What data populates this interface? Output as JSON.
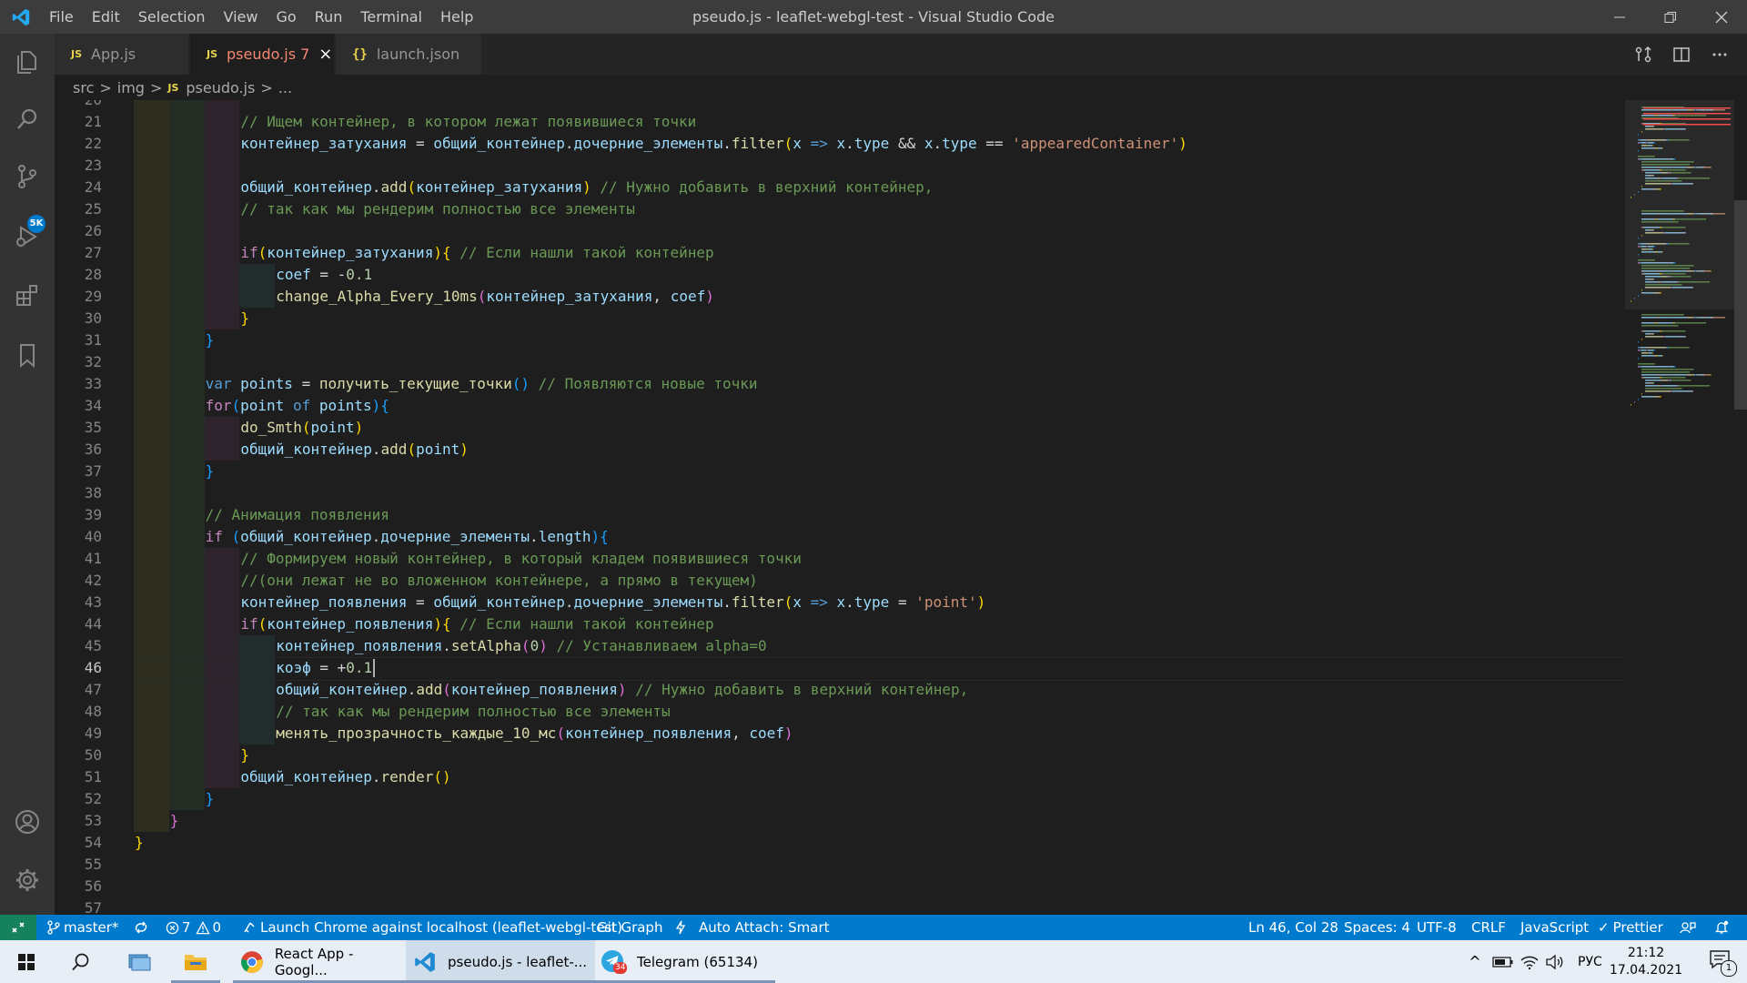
{
  "window": {
    "title": "pseudo.js - leaflet-webgl-test - Visual Studio Code",
    "menu": [
      "File",
      "Edit",
      "Selection",
      "View",
      "Go",
      "Run",
      "Terminal",
      "Help"
    ]
  },
  "activity_bar": {
    "items": [
      "explorer-icon",
      "search-icon",
      "source-control-icon",
      "run-debug-icon",
      "extensions-icon",
      "bookmarks-icon"
    ],
    "source_control_badge": "5K",
    "bottom_items": [
      "account-icon",
      "settings-gear-icon"
    ]
  },
  "tabs": [
    {
      "icon": "JS",
      "label": "App.js",
      "active": false
    },
    {
      "icon": "JS",
      "label": "pseudo.js 7",
      "active": true
    },
    {
      "icon": "{}",
      "label": "launch.json",
      "active": false
    }
  ],
  "breadcrumb": {
    "parts": [
      "src",
      "img"
    ],
    "file_icon": "JS",
    "file": "pseudo.js",
    "tail": "..."
  },
  "editor": {
    "current_line": 46,
    "lines": [
      {
        "n": 20,
        "indent": 3,
        "tokens": []
      },
      {
        "n": 21,
        "indent": 3,
        "tokens": [
          [
            "c",
            "// Ищем контейнер, в котором лежат появившиеся точки"
          ]
        ]
      },
      {
        "n": 22,
        "indent": 3,
        "tokens": [
          [
            "v",
            "контейнер_затухания"
          ],
          [
            "p",
            " = "
          ],
          [
            "v",
            "общий_контейнер"
          ],
          [
            "p",
            "."
          ],
          [
            "v",
            "дочерние_элементы"
          ],
          [
            "p",
            "."
          ],
          [
            "f",
            "filter"
          ],
          [
            "b1",
            "("
          ],
          [
            "v",
            "x"
          ],
          [
            "p",
            " "
          ],
          [
            "k",
            "=>"
          ],
          [
            "p",
            " "
          ],
          [
            "v",
            "x"
          ],
          [
            "p",
            "."
          ],
          [
            "v",
            "type"
          ],
          [
            "p",
            " && "
          ],
          [
            "v",
            "x"
          ],
          [
            "p",
            "."
          ],
          [
            "v",
            "type"
          ],
          [
            "p",
            " == "
          ],
          [
            "s",
            "'appearedContainer'"
          ],
          [
            "b1",
            ")"
          ]
        ]
      },
      {
        "n": 23,
        "indent": 3,
        "tokens": []
      },
      {
        "n": 24,
        "indent": 3,
        "tokens": [
          [
            "v",
            "общий_контейнер"
          ],
          [
            "p",
            "."
          ],
          [
            "f",
            "add"
          ],
          [
            "b1",
            "("
          ],
          [
            "v",
            "контейнер_затухания"
          ],
          [
            "b1",
            ")"
          ],
          [
            "p",
            " "
          ],
          [
            "c",
            "// Нужно добавить в верхний контейнер,"
          ]
        ]
      },
      {
        "n": 25,
        "indent": 3,
        "tokens": [
          [
            "c",
            "// так как мы рендерим полностью все элементы"
          ]
        ]
      },
      {
        "n": 26,
        "indent": 3,
        "tokens": []
      },
      {
        "n": 27,
        "indent": 3,
        "tokens": [
          [
            "kc",
            "if"
          ],
          [
            "b1",
            "("
          ],
          [
            "v",
            "контейнер_затухания"
          ],
          [
            "b1",
            ")"
          ],
          [
            "b1",
            "{"
          ],
          [
            "p",
            " "
          ],
          [
            "c",
            "// Если нашли такой контейнер"
          ]
        ]
      },
      {
        "n": 28,
        "indent": 4,
        "tokens": [
          [
            "v",
            "coef"
          ],
          [
            "p",
            " = "
          ],
          [
            "o",
            "-"
          ],
          [
            "nm",
            "0.1"
          ]
        ]
      },
      {
        "n": 29,
        "indent": 4,
        "tokens": [
          [
            "f",
            "change_Alpha_Every_10ms"
          ],
          [
            "b2",
            "("
          ],
          [
            "v",
            "контейнер_затухания"
          ],
          [
            "p",
            ", "
          ],
          [
            "v",
            "coef"
          ],
          [
            "b2",
            ")"
          ]
        ]
      },
      {
        "n": 30,
        "indent": 3,
        "tokens": [
          [
            "b1",
            "}"
          ]
        ]
      },
      {
        "n": 31,
        "indent": 2,
        "tokens": [
          [
            "b3",
            "}"
          ]
        ]
      },
      {
        "n": 32,
        "indent": 2,
        "tokens": []
      },
      {
        "n": 33,
        "indent": 2,
        "tokens": [
          [
            "k",
            "var"
          ],
          [
            "p",
            " "
          ],
          [
            "v",
            "points"
          ],
          [
            "p",
            " = "
          ],
          [
            "f",
            "получить_текущие_точки"
          ],
          [
            "b3",
            "()"
          ],
          [
            "p",
            " "
          ],
          [
            "c",
            "// Появляются новые точки"
          ]
        ]
      },
      {
        "n": 34,
        "indent": 2,
        "tokens": [
          [
            "kc",
            "for"
          ],
          [
            "b3",
            "("
          ],
          [
            "v",
            "point"
          ],
          [
            "p",
            " "
          ],
          [
            "k",
            "of"
          ],
          [
            "p",
            " "
          ],
          [
            "v",
            "points"
          ],
          [
            "b3",
            ")"
          ],
          [
            "b3",
            "{"
          ]
        ]
      },
      {
        "n": 35,
        "indent": 3,
        "tokens": [
          [
            "f",
            "do_Smth"
          ],
          [
            "b1",
            "("
          ],
          [
            "v",
            "point"
          ],
          [
            "b1",
            ")"
          ]
        ]
      },
      {
        "n": 36,
        "indent": 3,
        "tokens": [
          [
            "v",
            "общий_контейнер"
          ],
          [
            "p",
            "."
          ],
          [
            "f",
            "add"
          ],
          [
            "b1",
            "("
          ],
          [
            "v",
            "point"
          ],
          [
            "b1",
            ")"
          ]
        ]
      },
      {
        "n": 37,
        "indent": 2,
        "tokens": [
          [
            "b3",
            "}"
          ]
        ]
      },
      {
        "n": 38,
        "indent": 2,
        "tokens": []
      },
      {
        "n": 39,
        "indent": 2,
        "tokens": [
          [
            "c",
            "// Анимация появления"
          ]
        ]
      },
      {
        "n": 40,
        "indent": 2,
        "tokens": [
          [
            "kc",
            "if"
          ],
          [
            "p",
            " "
          ],
          [
            "b3",
            "("
          ],
          [
            "v",
            "общий_контейнер"
          ],
          [
            "p",
            "."
          ],
          [
            "v",
            "дочерние_элементы"
          ],
          [
            "p",
            "."
          ],
          [
            "v",
            "length"
          ],
          [
            "b3",
            ")"
          ],
          [
            "b3",
            "{"
          ]
        ]
      },
      {
        "n": 41,
        "indent": 3,
        "tokens": [
          [
            "c",
            "// Формируем новый контейнер, в который кладем появившиеся точки"
          ]
        ]
      },
      {
        "n": 42,
        "indent": 3,
        "tokens": [
          [
            "c",
            "//(они лежат не во вложенном контейнере, а прямо в текущем)"
          ]
        ]
      },
      {
        "n": 43,
        "indent": 3,
        "tokens": [
          [
            "v",
            "контейнер_появления"
          ],
          [
            "p",
            " = "
          ],
          [
            "v",
            "общий_контейнер"
          ],
          [
            "p",
            "."
          ],
          [
            "v",
            "дочерние_элементы"
          ],
          [
            "p",
            "."
          ],
          [
            "f",
            "filter"
          ],
          [
            "b1",
            "("
          ],
          [
            "v",
            "x"
          ],
          [
            "p",
            " "
          ],
          [
            "k",
            "=>"
          ],
          [
            "p",
            " "
          ],
          [
            "v",
            "x"
          ],
          [
            "p",
            "."
          ],
          [
            "v",
            "type"
          ],
          [
            "p",
            " = "
          ],
          [
            "s",
            "'point'"
          ],
          [
            "b1",
            ")"
          ]
        ]
      },
      {
        "n": 44,
        "indent": 3,
        "tokens": [
          [
            "kc",
            "if"
          ],
          [
            "b1",
            "("
          ],
          [
            "v",
            "контейнер_появления"
          ],
          [
            "b1",
            ")"
          ],
          [
            "b1",
            "{"
          ],
          [
            "p",
            " "
          ],
          [
            "c",
            "// Если нашли такой контейнер"
          ]
        ]
      },
      {
        "n": 45,
        "indent": 4,
        "tokens": [
          [
            "v",
            "контейнер_появления"
          ],
          [
            "p",
            "."
          ],
          [
            "f",
            "setAlpha"
          ],
          [
            "b2",
            "("
          ],
          [
            "nm",
            "0"
          ],
          [
            "b2",
            ")"
          ],
          [
            "p",
            " "
          ],
          [
            "c",
            "// Устанавливаем alpha=0"
          ]
        ]
      },
      {
        "n": 46,
        "indent": 4,
        "tokens": [
          [
            "v",
            "коэф"
          ],
          [
            "p",
            " = "
          ],
          [
            "o",
            "+"
          ],
          [
            "nm",
            "0.1"
          ]
        ]
      },
      {
        "n": 47,
        "indent": 4,
        "tokens": [
          [
            "v",
            "общий_контейнер"
          ],
          [
            "p",
            "."
          ],
          [
            "f",
            "add"
          ],
          [
            "b2",
            "("
          ],
          [
            "v",
            "контейнер_появления"
          ],
          [
            "b2",
            ")"
          ],
          [
            "p",
            " "
          ],
          [
            "c",
            "// Нужно добавить в верхний контейнер,"
          ]
        ]
      },
      {
        "n": 48,
        "indent": 4,
        "tokens": [
          [
            "c",
            "// так как мы рендерим полностью все элементы"
          ]
        ]
      },
      {
        "n": 49,
        "indent": 4,
        "tokens": [
          [
            "f",
            "менять_прозрачность_каждые_10_мс"
          ],
          [
            "b2",
            "("
          ],
          [
            "v",
            "контейнер_появления"
          ],
          [
            "p",
            ", "
          ],
          [
            "v",
            "coef"
          ],
          [
            "b2",
            ")"
          ]
        ]
      },
      {
        "n": 50,
        "indent": 3,
        "tokens": [
          [
            "b1",
            "}"
          ]
        ]
      },
      {
        "n": 51,
        "indent": 3,
        "tokens": [
          [
            "v",
            "общий_контейнер"
          ],
          [
            "p",
            "."
          ],
          [
            "f",
            "render"
          ],
          [
            "b1",
            "()"
          ]
        ]
      },
      {
        "n": 52,
        "indent": 2,
        "tokens": [
          [
            "b3",
            "}"
          ]
        ]
      },
      {
        "n": 53,
        "indent": 1,
        "tokens": [
          [
            "b2",
            "}"
          ]
        ]
      },
      {
        "n": 54,
        "indent": 0,
        "tokens": [
          [
            "b1",
            "}"
          ]
        ]
      },
      {
        "n": 55,
        "indent": 0,
        "tokens": []
      },
      {
        "n": 56,
        "indent": 0,
        "tokens": []
      },
      {
        "n": 57,
        "indent": 0,
        "tokens": []
      }
    ]
  },
  "status_bar": {
    "branch": "master*",
    "errors": "7",
    "warnings": "0",
    "launch_config": "Launch Chrome against localhost (leaflet-webgl-test)",
    "git_graph": "Git Graph",
    "auto_attach": "Auto Attach: Smart",
    "cursor_position": "Ln 46, Col 28",
    "indentation": "Spaces: 4",
    "encoding": "UTF-8",
    "eol": "CRLF",
    "language": "JavaScript",
    "formatter": "Prettier"
  },
  "taskbar": {
    "apps": [
      {
        "name": "React App - Googl...",
        "icon": "chrome-icon",
        "active": false
      },
      {
        "name": "pseudo.js - leaflet-...",
        "icon": "vscode-icon",
        "active": true
      },
      {
        "name": "Telegram (65134)",
        "icon": "telegram-icon",
        "active": false,
        "badge": "34"
      }
    ],
    "language": "РУС",
    "time": "21:12",
    "date": "17.04.2021",
    "notification_count": "1"
  },
  "colors": {
    "accent": "#007acc",
    "comment": "#6a9955",
    "string": "#ce9178",
    "keyword": "#569cd6",
    "control_keyword": "#c586c0",
    "function": "#dcdcaa",
    "variable": "#9cdcfe",
    "number": "#b5cea8",
    "bracket_gold": "#ffd700",
    "bracket_orchid": "#da70d6",
    "bracket_blue": "#179fff",
    "error_tab": "#f48771"
  }
}
